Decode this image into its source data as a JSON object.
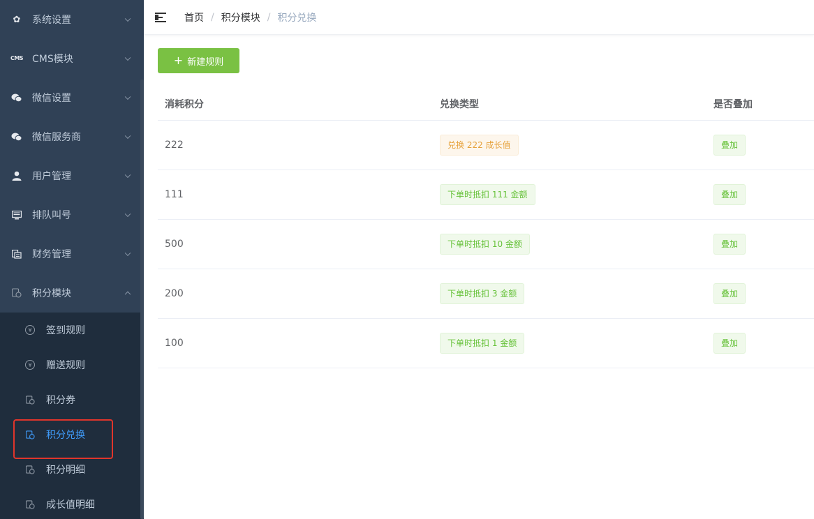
{
  "sidebar": {
    "items": [
      {
        "label": "系统设置",
        "icon": "gear-icon"
      },
      {
        "label": "CMS模块",
        "icon": "cms-icon",
        "icon_text": "CMS"
      },
      {
        "label": "微信设置",
        "icon": "wechat-icon"
      },
      {
        "label": "微信服务商",
        "icon": "wechat-icon"
      },
      {
        "label": "用户管理",
        "icon": "user-icon"
      },
      {
        "label": "排队叫号",
        "icon": "monitor-icon"
      },
      {
        "label": "财务管理",
        "icon": "finance-icon"
      },
      {
        "label": "积分模块",
        "icon": "points-icon",
        "expanded": true
      }
    ],
    "subitems": [
      {
        "label": "签到规则",
        "icon": "coin-icon"
      },
      {
        "label": "赠送规则",
        "icon": "coin-icon"
      },
      {
        "label": "积分券",
        "icon": "points-icon"
      },
      {
        "label": "积分兑换",
        "icon": "points-icon",
        "active": true
      },
      {
        "label": "积分明细",
        "icon": "points-icon"
      },
      {
        "label": "成长值明细",
        "icon": "points-icon"
      }
    ]
  },
  "header": {
    "breadcrumb": [
      "首页",
      "积分模块",
      "积分兑换"
    ],
    "separator": "/"
  },
  "toolbar": {
    "new_button_label": "新建规则",
    "new_button_icon": "+"
  },
  "table": {
    "columns": [
      "消耗积分",
      "兑换类型",
      "是否叠加"
    ],
    "rows": [
      {
        "points": "222",
        "type": "兑换 222 成长值",
        "type_style": "warning",
        "stack": "叠加"
      },
      {
        "points": "111",
        "type": "下单时抵扣 111 金额",
        "type_style": "success",
        "stack": "叠加"
      },
      {
        "points": "500",
        "type": "下单时抵扣 10 金额",
        "type_style": "success",
        "stack": "叠加"
      },
      {
        "points": "200",
        "type": "下单时抵扣 3 金额",
        "type_style": "success",
        "stack": "叠加"
      },
      {
        "points": "100",
        "type": "下单时抵扣 1 金额",
        "type_style": "success",
        "stack": "叠加"
      }
    ]
  },
  "colors": {
    "sidebar_bg": "#304156",
    "submenu_bg": "#1f2d3d",
    "active_text": "#409eff",
    "primary_button": "#7ac143",
    "highlight_border": "#e0352b"
  }
}
